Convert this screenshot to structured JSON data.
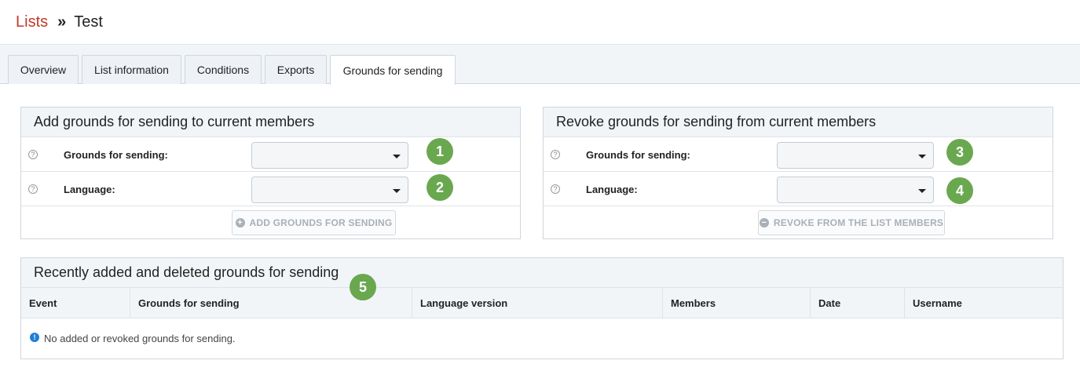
{
  "breadcrumb": {
    "parent": "Lists",
    "separator": "»",
    "current": "Test"
  },
  "tabs": [
    {
      "label": "Overview"
    },
    {
      "label": "List information"
    },
    {
      "label": "Conditions"
    },
    {
      "label": "Exports"
    },
    {
      "label": "Grounds for sending",
      "active": true
    }
  ],
  "add_panel": {
    "title": "Add grounds for sending to current members",
    "grounds_label": "Grounds for sending:",
    "language_label": "Language:",
    "grounds_value": "",
    "language_value": "",
    "button_label": "ADD GROUNDS FOR SENDING",
    "button_icon": "+"
  },
  "revoke_panel": {
    "title": "Revoke grounds for sending from current members",
    "grounds_label": "Grounds for sending:",
    "language_label": "Language:",
    "grounds_value": "",
    "language_value": "",
    "button_label": "REVOKE FROM THE LIST MEMBERS",
    "button_icon": "−"
  },
  "history_panel": {
    "title": "Recently added and deleted grounds for sending",
    "columns": [
      "Event",
      "Grounds for sending",
      "Language version",
      "Members",
      "Date",
      "Username"
    ],
    "empty_message": "No added or revoked grounds for sending."
  },
  "badges": [
    "1",
    "2",
    "3",
    "4",
    "5"
  ],
  "colors": {
    "accent_link": "#c0392b",
    "badge": "#6aa84f",
    "info": "#1e7fd6"
  },
  "icons": {
    "help": "?",
    "info": "!"
  }
}
